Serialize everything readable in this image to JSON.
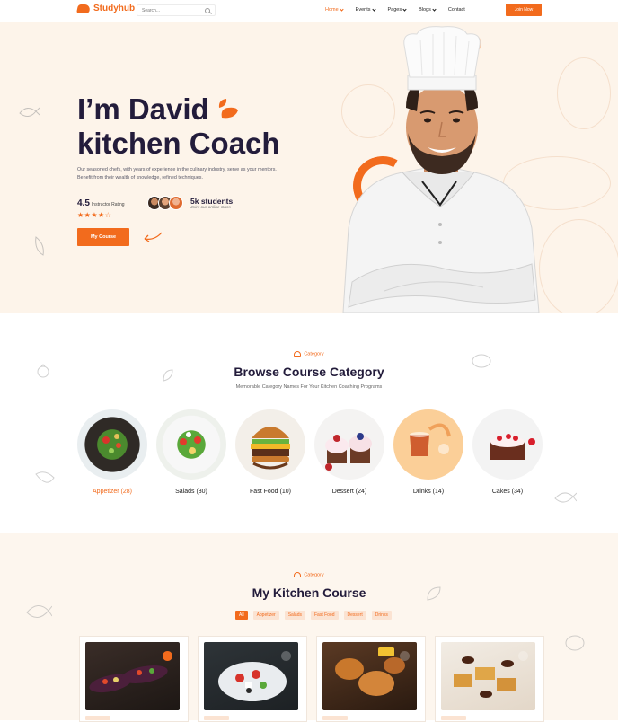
{
  "brand": {
    "name": "Studyhub",
    "accent": "#f26b1d"
  },
  "header": {
    "search_placeholder": "Search...",
    "nav": [
      {
        "label": "Home",
        "active": true,
        "dropdown": true
      },
      {
        "label": "Events",
        "active": false,
        "dropdown": true
      },
      {
        "label": "Pages",
        "active": false,
        "dropdown": true
      },
      {
        "label": "Blogs",
        "active": false,
        "dropdown": true
      },
      {
        "label": "Contact",
        "active": false,
        "dropdown": false
      }
    ],
    "join_label": "Join Now"
  },
  "hero": {
    "title_line1": "I’m David",
    "title_line2": "kitchen Coach",
    "description": "Our seasoned chefs, with years of experience in the culinary industry, serve as your mentors. Benefit from their wealth of knowledge, refined techniques.",
    "rating_value": "4.5",
    "rating_label": "Instructor Rating",
    "stars": "★★★★☆",
    "rating_stars": 4,
    "students_count": "5k students",
    "students_sub": "Joint our online Cass",
    "cta_label": "My Course"
  },
  "categories": {
    "tag": "Category",
    "title": "Browse Course Category",
    "subtitle": "Memorable Category Names For Your Kitchen Coaching Programs",
    "items": [
      {
        "label": "Appetizer (28)",
        "active": true,
        "icon": "salad-bowl"
      },
      {
        "label": "Salads (30)",
        "active": false,
        "icon": "salad-plate"
      },
      {
        "label": "Fast Food (10)",
        "active": false,
        "icon": "burger"
      },
      {
        "label": "Dessert (24)",
        "active": false,
        "icon": "cupcakes"
      },
      {
        "label": "Drinks (14)",
        "active": false,
        "icon": "tea-glass"
      },
      {
        "label": "Cakes (34)",
        "active": false,
        "icon": "berry-cake"
      }
    ]
  },
  "courses": {
    "tag": "Category",
    "title": "My Kitchen Course",
    "filters": [
      "All",
      "Appetizer",
      "Salads",
      "Fast Food",
      "Dessert",
      "Drinks"
    ],
    "active_filter": "All",
    "cards": [
      {
        "image": "stuffed-eggplant"
      },
      {
        "image": "greek-salad"
      },
      {
        "image": "fried-chicken"
      },
      {
        "image": "baklava-dates"
      }
    ]
  }
}
